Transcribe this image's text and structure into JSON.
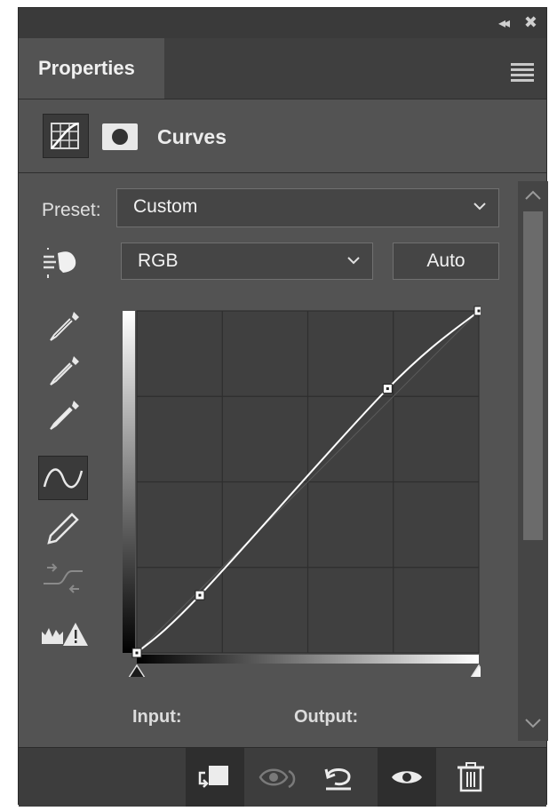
{
  "panel": {
    "tab_label": "Properties",
    "adjustment_title": "Curves"
  },
  "preset": {
    "label": "Preset:",
    "value": "Custom"
  },
  "channel": {
    "value": "RGB",
    "auto_label": "Auto"
  },
  "curve": {
    "type": "line",
    "x_range": [
      0,
      255
    ],
    "y_range": [
      0,
      255
    ],
    "control_points": [
      {
        "x": 0,
        "y": 0
      },
      {
        "x": 47,
        "y": 43
      },
      {
        "x": 187,
        "y": 197
      },
      {
        "x": 255,
        "y": 255
      }
    ],
    "grid": "4x4"
  },
  "readout": {
    "input_label": "Input:",
    "output_label": "Output:"
  },
  "icons": {
    "collapse": "double-chevron-left-icon",
    "close": "close-icon",
    "menu": "hamburger-menu-icon",
    "adjustment": "curves-grid-icon",
    "mask": "layer-mask-icon",
    "target_adjust": "on-image-adjust-icon",
    "eyedroppers": [
      "black-point-eyedropper-icon",
      "gray-point-eyedropper-icon",
      "white-point-eyedropper-icon"
    ],
    "curve_point": "curve-point-tool-icon",
    "pencil": "pencil-draw-icon",
    "smooth": "smooth-curve-icon",
    "clipping": "clipping-warning-icon",
    "footer": [
      "clip-to-layer-icon",
      "view-previous-state-icon",
      "reset-icon",
      "visibility-eye-icon",
      "trash-icon"
    ]
  },
  "colors": {
    "panel_bg": "#535353",
    "dark_bg": "#3a3a3a",
    "text": "#e0e0e0"
  }
}
